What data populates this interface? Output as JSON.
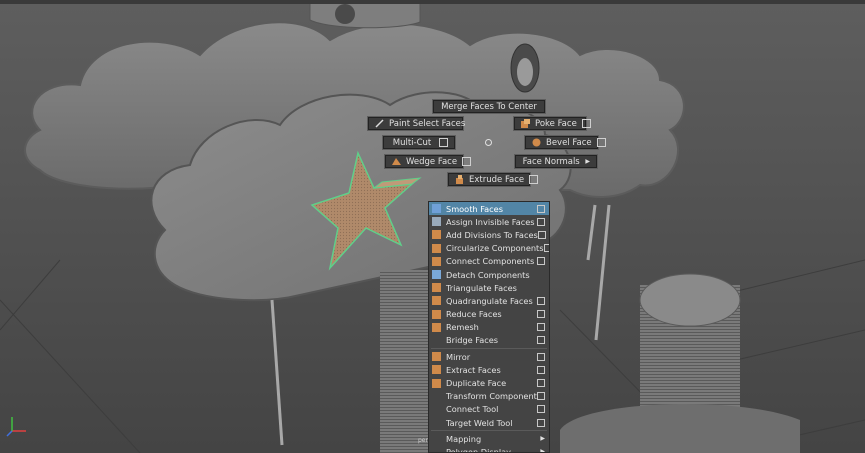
{
  "viewport": {
    "camera_label": "per"
  },
  "marking_menu": {
    "north": "Merge Faces To Center",
    "north_west": "Paint Select Faces",
    "north_east": "Poke Face",
    "west": "Multi-Cut",
    "east": "Bevel Face",
    "south_west": "Wedge Face",
    "south_east": "Face Normals",
    "south": "Extrude Face"
  },
  "context_menu": {
    "items": [
      {
        "label": "Smooth Faces",
        "icon": "smooth-faces-icon",
        "box": true
      },
      {
        "label": "Assign Invisible Faces",
        "icon": "invisible-faces-icon",
        "box": true
      },
      {
        "label": "Add Divisions To Faces",
        "icon": "add-divisions-icon",
        "box": true
      },
      {
        "label": "Circularize Components",
        "icon": "circularize-icon",
        "box": true
      },
      {
        "label": "Connect Components",
        "icon": "connect-components-icon",
        "box": true
      },
      {
        "label": "Detach Components",
        "icon": "detach-components-icon",
        "box": false
      },
      {
        "label": "Triangulate Faces",
        "icon": "triangulate-icon",
        "box": false
      },
      {
        "label": "Quadrangulate Faces",
        "icon": "quadrangulate-icon",
        "box": true
      },
      {
        "label": "Reduce Faces",
        "icon": "reduce-faces-icon",
        "box": true
      },
      {
        "label": "Remesh",
        "icon": "remesh-icon",
        "box": true
      },
      {
        "label": "Bridge Faces",
        "icon": "",
        "box": true
      },
      {
        "label": "Mirror",
        "icon": "mirror-icon",
        "box": true
      },
      {
        "label": "Extract Faces",
        "icon": "extract-faces-icon",
        "box": true
      },
      {
        "label": "Duplicate Face",
        "icon": "duplicate-face-icon",
        "box": true
      },
      {
        "label": "Transform Component",
        "icon": "",
        "box": true
      },
      {
        "label": "Connect Tool",
        "icon": "",
        "box": true
      },
      {
        "label": "Target Weld Tool",
        "icon": "",
        "box": true
      },
      {
        "label": "Mapping",
        "icon": "",
        "box": false,
        "submenu": true
      },
      {
        "label": "Polygon Display",
        "icon": "",
        "box": false,
        "submenu": true
      }
    ]
  },
  "colors": {
    "menu_highlight": "#5285a6",
    "selection_green": "#5fd08a",
    "selected_face_fill": "#b08a6a"
  }
}
